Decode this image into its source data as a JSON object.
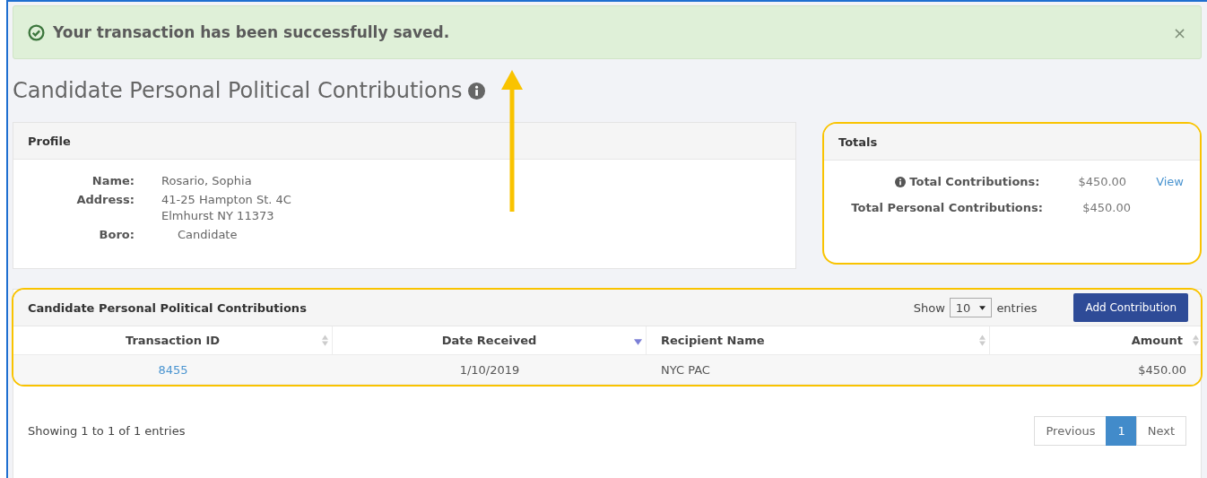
{
  "alert": {
    "message": "Your transaction has been successfully saved.",
    "close": "×"
  },
  "title": "Candidate Personal Political Contributions",
  "profile": {
    "heading": "Profile",
    "fields": [
      {
        "label": "Name:",
        "lines": [
          "Rosario, Sophia"
        ]
      },
      {
        "label": "Address:",
        "lines": [
          "41-25 Hampton St. 4C",
          "Elmhurst NY 11373"
        ]
      },
      {
        "label": "Boro:",
        "lines": [
          "Candidate"
        ]
      }
    ]
  },
  "totals": {
    "heading": "Totals",
    "rows": [
      {
        "label": "Total Contributions:",
        "value": "$450.00",
        "link": "View",
        "info": true
      },
      {
        "label": "Total Personal Contributions:",
        "value": "$450.00",
        "info": false
      }
    ]
  },
  "table": {
    "heading": "Candidate Personal Political Contributions",
    "show_label": "Show",
    "page_size": "10",
    "entries_label": "entries",
    "add_button": "Add Contribution",
    "columns": [
      {
        "label": "Transaction ID",
        "sorted": false
      },
      {
        "label": "Date Received",
        "sorted": true
      },
      {
        "label": "Recipient Name",
        "sorted": false
      },
      {
        "label": "Amount",
        "sorted": false
      }
    ],
    "rows": [
      [
        "8455",
        "1/10/2019",
        "NYC PAC",
        "$450.00"
      ]
    ],
    "info": "Showing 1 to 1 of 1 entries",
    "pagination": {
      "previous": "Previous",
      "next": "Next",
      "pages": [
        {
          "label": "1",
          "selected": true
        }
      ]
    }
  }
}
